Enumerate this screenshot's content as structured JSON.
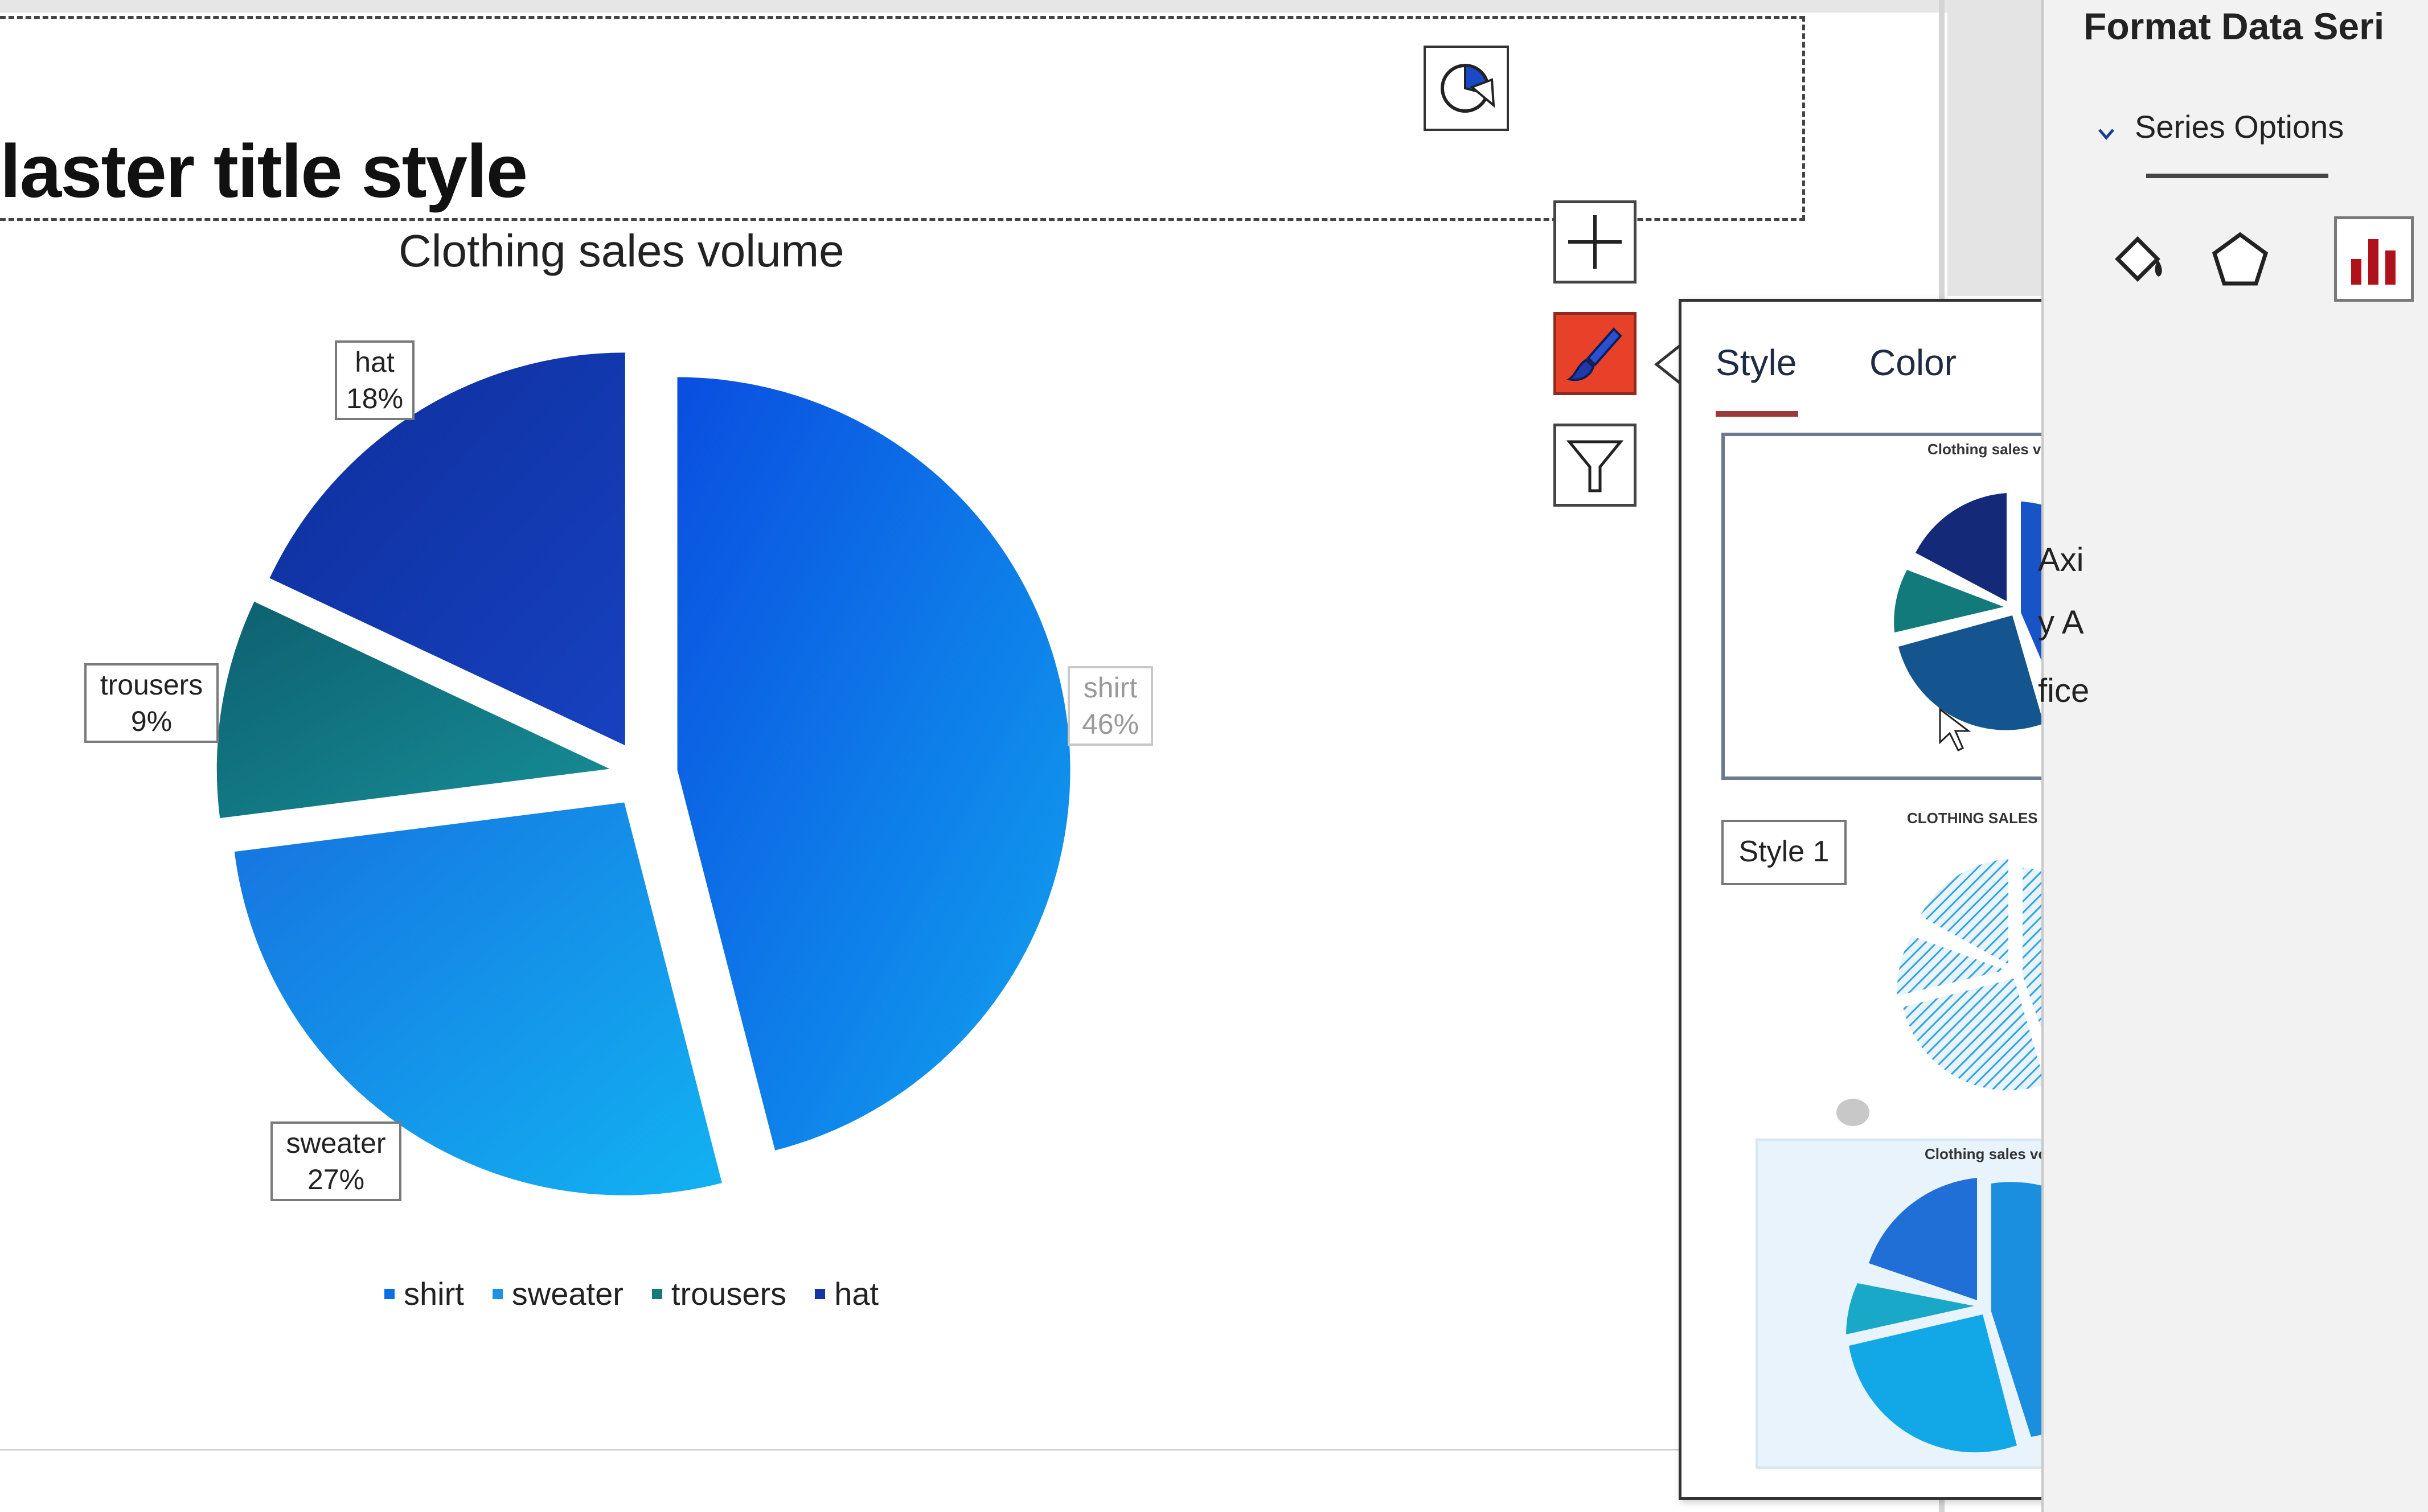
{
  "slide": {
    "title": "laster title style"
  },
  "chart_data": {
    "type": "pie",
    "title": "Clothing sales volume",
    "categories": [
      "shirt",
      "sweater",
      "trousers",
      "hat"
    ],
    "values": [
      46,
      27,
      9,
      18
    ],
    "labels": [
      "46%",
      "27%",
      "9%",
      "18%"
    ],
    "legend": "bottom",
    "colors": [
      "#0a6ee8",
      "#1e90e6",
      "#157a7a",
      "#1434a8"
    ]
  },
  "chart_tools": {
    "add_element_icon": "plus-icon",
    "styles_icon": "brush-icon",
    "filter_icon": "filter-icon"
  },
  "styles_panel": {
    "tabs": [
      "Style",
      "Color"
    ],
    "active_tab": "Style",
    "tooltip": "Style 1",
    "thumb_titles": [
      "Clothing sales volume",
      "CLOTHING SALES VOLUME",
      "Clothing sales volume"
    ]
  },
  "format_pane": {
    "title": "Format Data Seri",
    "section": "Series Options",
    "icons": [
      "fill-bucket-icon",
      "pentagon-icon",
      "bar-chart-icon"
    ],
    "fragments": [
      "Axi",
      "y A",
      "fice"
    ]
  }
}
